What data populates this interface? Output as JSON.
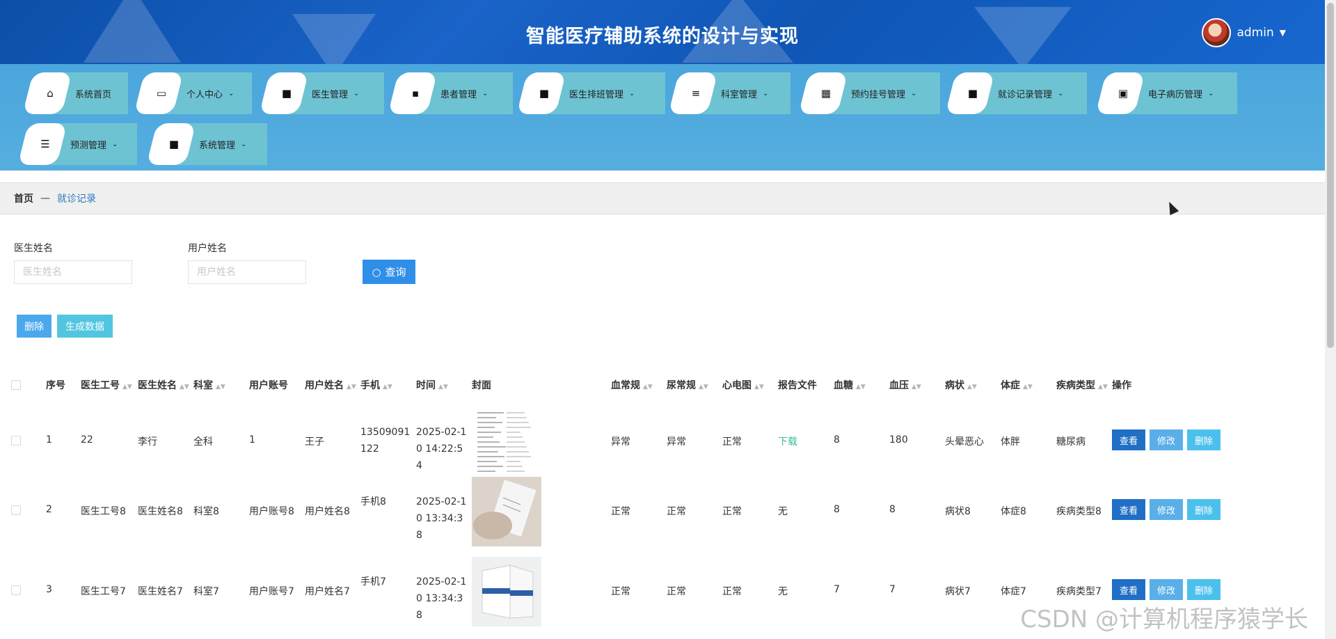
{
  "header": {
    "title": "智能医疗辅助系统的设计与实现",
    "user": "admin"
  },
  "nav": [
    {
      "label": "系统首页",
      "icon": "home-icon",
      "dropdown": false
    },
    {
      "label": "个人中心",
      "icon": "wallet-icon",
      "dropdown": true
    },
    {
      "label": "医生管理",
      "icon": "grid-icon",
      "dropdown": true
    },
    {
      "label": "患者管理",
      "icon": "chat-icon",
      "dropdown": true
    },
    {
      "label": "医生排班管理",
      "icon": "grid-icon",
      "dropdown": true
    },
    {
      "label": "科室管理",
      "icon": "list-icon",
      "dropdown": true
    },
    {
      "label": "预约挂号管理",
      "icon": "apps-icon",
      "dropdown": true
    },
    {
      "label": "就诊记录管理",
      "icon": "grid-icon",
      "dropdown": true
    },
    {
      "label": "电子病历管理",
      "icon": "briefcase-icon",
      "dropdown": true
    },
    {
      "label": "预测管理",
      "icon": "sliders-icon",
      "dropdown": true
    },
    {
      "label": "系统管理",
      "icon": "grid-icon",
      "dropdown": true
    }
  ],
  "breadcrumb": {
    "home": "首页",
    "separator": "—",
    "current": "就诊记录"
  },
  "search": {
    "doctor_label": "医生姓名",
    "doctor_placeholder": "医生姓名",
    "user_label": "用户姓名",
    "user_placeholder": "用户姓名",
    "query_button": "查询"
  },
  "actions": {
    "delete": "删除",
    "generate": "生成数据"
  },
  "table": {
    "headers": [
      "序号",
      "医生工号",
      "医生姓名",
      "科室",
      "用户账号",
      "用户姓名",
      "手机",
      "时间",
      "封面",
      "血常规",
      "尿常规",
      "心电图",
      "报告文件",
      "血糖",
      "血压",
      "病状",
      "体症",
      "疾病类型",
      "操作"
    ],
    "rows": [
      {
        "no": "1",
        "doc_id": "22",
        "doc_name": "李行",
        "dept": "全科",
        "account": "1",
        "user": "王子",
        "phone": "13509091122",
        "time": "2025-02-10 14:22:54",
        "blood": "异常",
        "urine": "异常",
        "ecg": "正常",
        "report": "下载",
        "sugar": "8",
        "pressure": "180",
        "symptom": "头晕恶心",
        "sign": "体胖",
        "disease": "糖尿病"
      },
      {
        "no": "2",
        "doc_id": "医生工号8",
        "doc_name": "医生姓名8",
        "dept": "科室8",
        "account": "用户账号8",
        "user": "用户姓名8",
        "phone": "手机8",
        "time": "2025-02-10 13:34:38",
        "blood": "正常",
        "urine": "正常",
        "ecg": "正常",
        "report": "无",
        "sugar": "8",
        "pressure": "8",
        "symptom": "病状8",
        "sign": "体症8",
        "disease": "疾病类型8"
      },
      {
        "no": "3",
        "doc_id": "医生工号7",
        "doc_name": "医生姓名7",
        "dept": "科室7",
        "account": "用户账号7",
        "user": "用户姓名7",
        "phone": "手机7",
        "time": "2025-02-10 13:34:38",
        "blood": "正常",
        "urine": "正常",
        "ecg": "正常",
        "report": "无",
        "sugar": "7",
        "pressure": "7",
        "symptom": "病状7",
        "sign": "体症7",
        "disease": "疾病类型7"
      }
    ],
    "row_buttons": {
      "view": "查看",
      "edit": "修改",
      "delete": "删除"
    }
  },
  "watermark": "CSDN @计算机程序猿学长",
  "colors": {
    "header": "#0f56b5",
    "nav": "#4aa6dc",
    "nav_item": "#6ec3d3",
    "primary": "#2f8fe8",
    "link": "#3bbd9f"
  }
}
